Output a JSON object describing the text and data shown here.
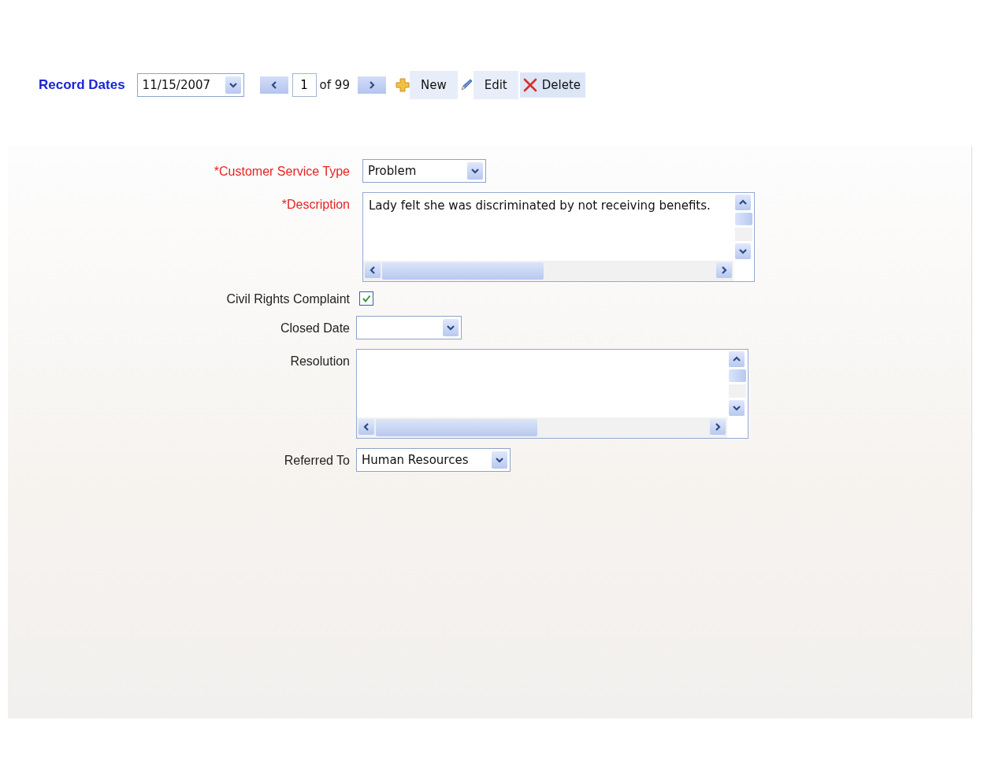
{
  "toolbar": {
    "label": "Record Dates",
    "date_select": {
      "value": "11/15/2007"
    },
    "pager": {
      "page": "1",
      "of_text": "of 99"
    },
    "buttons": [
      {
        "kind": "new",
        "label": "New"
      },
      {
        "kind": "edit",
        "label": "Edit"
      },
      {
        "kind": "delete",
        "label": "Delete"
      }
    ]
  },
  "form": {
    "fields": [
      {
        "kind": "select",
        "label": "*Customer Service Type",
        "required": true,
        "value": "Problem"
      },
      {
        "kind": "textarea",
        "label": "*Description",
        "required": true,
        "value": "Lady felt she was discriminated by not receiving benefits."
      },
      {
        "kind": "checkbox",
        "label": "Civil Rights Complaint",
        "required": false,
        "checked": true
      },
      {
        "kind": "select",
        "label": "Closed Date",
        "required": false
      },
      {
        "kind": "textarea",
        "label": "Resolution",
        "required": false
      },
      {
        "kind": "select",
        "label": "Referred To",
        "required": false,
        "value": "Human Resources"
      }
    ]
  }
}
